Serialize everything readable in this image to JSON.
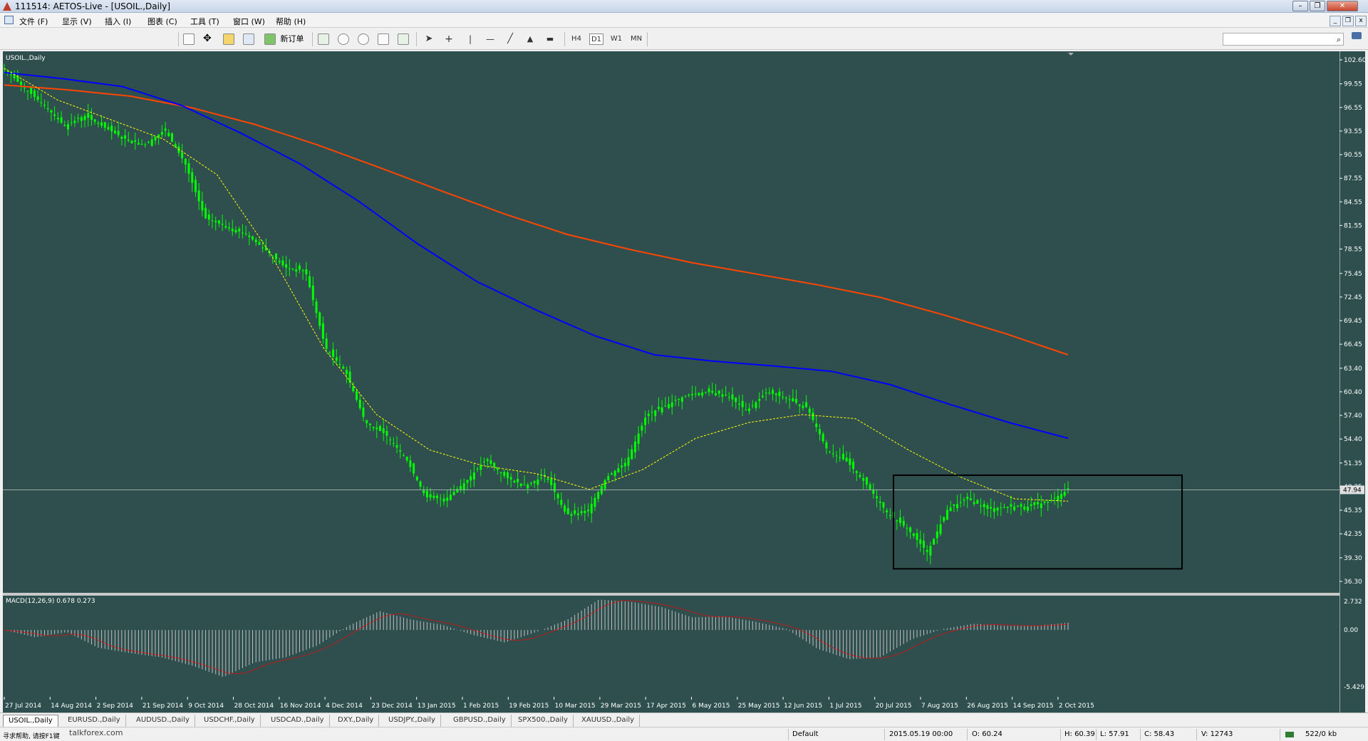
{
  "window": {
    "title": "111514: AETOS-Live - [USOIL.,Daily]"
  },
  "menu": [
    {
      "label": "文件 (F)"
    },
    {
      "label": "显示 (V)"
    },
    {
      "label": "插入 (I)"
    },
    {
      "label": "图表 (C)"
    },
    {
      "label": "工具 (T)"
    },
    {
      "label": "窗口 (W)"
    },
    {
      "label": "帮助 (H)"
    }
  ],
  "toolbar": {
    "new_order": "新订单",
    "timeframes": [
      "H4",
      "D1",
      "W1",
      "MN"
    ],
    "active_timeframe": "D1"
  },
  "chart": {
    "symbol_label": "USOIL.,Daily",
    "macd_label": "MACD(12,26,9) 0.678 0.273",
    "current_price": "47.94",
    "price_ticks": [
      "102.60",
      "99.55",
      "96.55",
      "93.55",
      "90.55",
      "87.55",
      "84.55",
      "81.55",
      "78.55",
      "75.45",
      "72.45",
      "69.45",
      "66.45",
      "63.40",
      "60.40",
      "57.40",
      "54.40",
      "51.35",
      "48.35",
      "45.35",
      "42.35",
      "39.30",
      "36.30"
    ],
    "macd_ticks": [
      "2.732",
      "0.00",
      "-5.429"
    ],
    "dates": [
      "27 Jul 2014",
      "14 Aug 2014",
      "2 Sep 2014",
      "21 Sep 2014",
      "9 Oct 2014",
      "28 Oct 2014",
      "16 Nov 2014",
      "4 Dec 2014",
      "23 Dec 2014",
      "13 Jan 2015",
      "1 Feb 2015",
      "19 Feb 2015",
      "10 Mar 2015",
      "29 Mar 2015",
      "17 Apr 2015",
      "6 May 2015",
      "25 May 2015",
      "12 Jun 2015",
      "1 Jul 2015",
      "20 Jul 2015",
      "7 Aug 2015",
      "26 Aug 2015",
      "14 Sep 2015",
      "2 Oct 2015"
    ],
    "colors": {
      "background": "#2f4f4f",
      "candles": "#00ff00",
      "ma_slow": "#ff4500",
      "ma_mid": "#0000ff",
      "ma_fast": "#ffff00",
      "macd_hist": "#c0c0c0",
      "macd_signal": "#ff0000"
    }
  },
  "chart_data": {
    "type": "line",
    "series": [
      {
        "key": "close",
        "values": [
          101.5,
          99.0,
          96.8,
          94.2,
          95.5,
          94.0,
          92.6,
          91.8,
          93.7,
          89.5,
          82.5,
          81.5,
          80.5,
          78.5,
          76.2,
          75.8,
          66.0,
          63.0,
          56.5,
          55.0,
          52.0,
          47.0,
          46.8,
          49.0,
          51.8,
          49.5,
          48.5,
          49.8,
          44.8,
          45.0,
          49.5,
          51.5,
          57.5,
          58.7,
          60.0,
          60.4,
          60.0,
          58.0,
          60.4,
          59.5,
          58.4,
          53.0,
          51.5,
          48.5,
          45.0,
          43.0,
          40.0,
          45.5,
          46.8,
          45.5,
          45.8,
          45.8,
          46.4,
          47.94
        ]
      },
      {
        "key": "ma_slow",
        "values": [
          99.4,
          98.8,
          98.0,
          96.5,
          94.4,
          91.8,
          88.9,
          85.9,
          83.0,
          80.4,
          78.5,
          76.8,
          75.4,
          74.0,
          72.4,
          70.2,
          67.8,
          65.1
        ]
      },
      {
        "key": "ma_mid",
        "values": [
          101.0,
          100.2,
          99.2,
          96.8,
          93.3,
          89.4,
          84.6,
          79.2,
          74.4,
          70.8,
          67.5,
          65.1,
          64.3,
          63.7,
          63.0,
          61.3,
          58.8,
          56.5,
          54.5
        ]
      },
      {
        "key": "ma_fast",
        "values": [
          101.5,
          97.5,
          95.0,
          92.5,
          88.0,
          78.0,
          66.0,
          57.5,
          53.0,
          51.0,
          50.0,
          48.0,
          50.5,
          54.5,
          56.5,
          57.5,
          57.0,
          53.0,
          49.5,
          46.8,
          46.5
        ]
      },
      {
        "key": "macd",
        "values": [
          0,
          -0.7,
          -0.2,
          -1.7,
          -2.2,
          -2.6,
          -3.4,
          -4.5,
          -3.1,
          -2.6,
          -1.5,
          0.4,
          1.8,
          1.0,
          0.5,
          -0.5,
          -1.2,
          -0.2,
          1.0,
          2.9,
          2.7,
          2.2,
          1.2,
          1.3,
          0.8,
          0.1,
          -1.8,
          -2.8,
          -2.6,
          -0.9,
          0.1,
          0.6,
          0.4,
          0.4,
          0.7
        ]
      }
    ],
    "ylim": [
      36.3,
      102.6
    ],
    "annotations": [
      "rectangle"
    ]
  },
  "symbol_tabs": [
    "USOIL.,Daily",
    "EURUSD.,Daily",
    "AUDUSD.,Daily",
    "USDCHF.,Daily",
    "USDCAD.,Daily",
    "DXY.,Daily",
    "USDJPY.,Daily",
    "GBPUSD.,Daily",
    "SPX500.,Daily",
    "XAUUSD.,Daily"
  ],
  "status": {
    "profile": "Default",
    "datetime": "2015.05.19 00:00",
    "open": "O: 60.24",
    "high": "H: 60.39",
    "low": "L: 57.91",
    "close": "C: 58.43",
    "volume": "V: 12743",
    "traffic": "522/0 kb"
  },
  "watermark": {
    "site": "talkforex.com",
    "hint": "寻求帮助, 请按F1键"
  }
}
